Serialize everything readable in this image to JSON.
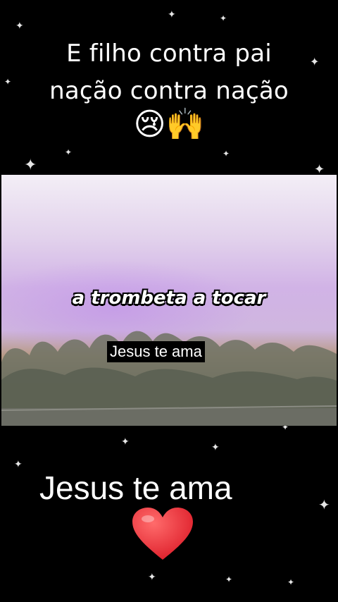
{
  "top_caption": {
    "line1": "E filho contra pai",
    "line2": "nação contra nação",
    "emojis": "😢🙌"
  },
  "video": {
    "overlay_text": "a trombeta a tocar",
    "label": "Jesus te ama"
  },
  "bottom_caption": {
    "text": "Jesus te ama",
    "heart_color": "#e0242f"
  }
}
